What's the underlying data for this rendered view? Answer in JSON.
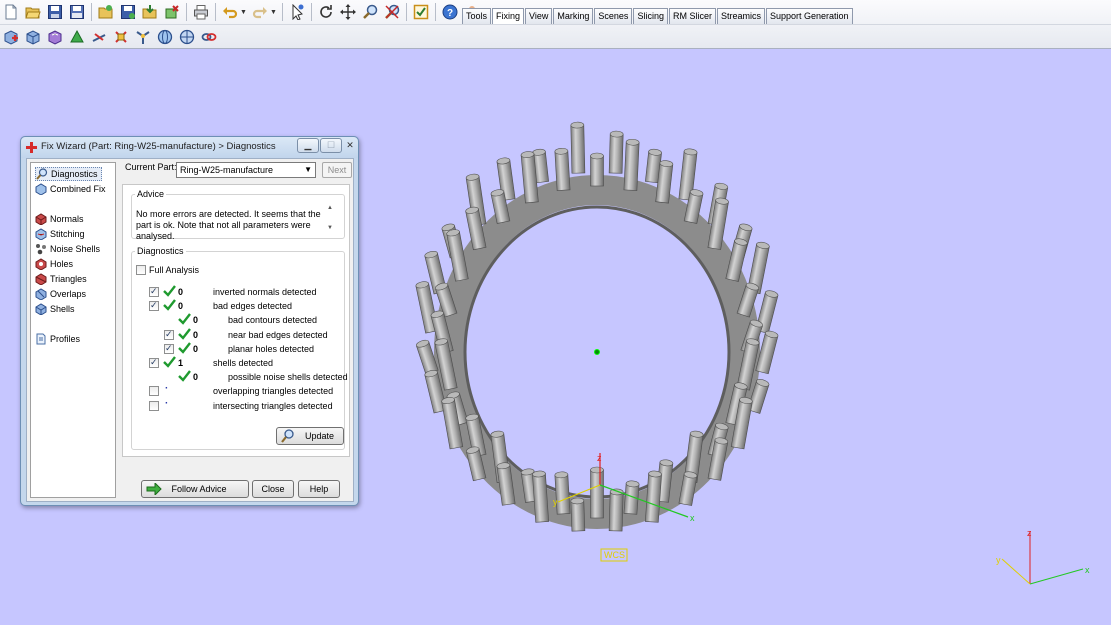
{
  "toolbar": {
    "row1_icons": [
      "new-file-icon",
      "open-folder-icon",
      "save-icon",
      "save-as-icon",
      "open-project-icon",
      "save-project-icon",
      "import-icon",
      "export-icon",
      "print-icon",
      "undo-icon",
      "redo-icon",
      "select-icon",
      "rotate-icon",
      "pan-icon",
      "zoom-icon",
      "zoom-extents-icon",
      "checklist-icon",
      "help-icon",
      "tools-wizard-icon"
    ],
    "row2_icons": [
      "fix-wizard-icon",
      "normals-icon",
      "stitch-icon",
      "triangles-icon",
      "cut-icon",
      "trim-icon",
      "marker-icon",
      "sphere-icon",
      "globe-icon",
      "link-icon"
    ],
    "tabs": [
      "Tools",
      "Fixing",
      "View",
      "Marking",
      "Scenes",
      "Slicing",
      "RM Slicer",
      "Streamics",
      "Support Generation"
    ],
    "active_tab": "Fixing"
  },
  "dialog": {
    "title": "Fix Wizard (Part: Ring-W25-manufacture) > Diagnostics",
    "nav": {
      "top": [
        "Diagnostics",
        "Combined Fix"
      ],
      "middle": [
        "Normals",
        "Stitching",
        "Noise Shells",
        "Holes",
        "Triangles",
        "Overlaps",
        "Shells"
      ],
      "bottom": [
        "Profiles"
      ],
      "selected": "Diagnostics"
    },
    "current_part_label": "Current Part:",
    "current_part_value": "Ring-W25-manufacture",
    "next_button": "Next",
    "advice": {
      "legend": "Advice",
      "text": "No more errors are detected. It seems that the part is ok. Note that not all parameters were analysed."
    },
    "diagnostics": {
      "legend": "Diagnostics",
      "full_analysis_label": "Full Analysis",
      "rows": [
        {
          "label": "inverted normals detected",
          "count": "0",
          "checked": true,
          "status": "ok"
        },
        {
          "label": "bad edges detected",
          "count": "0",
          "checked": true,
          "status": "ok"
        },
        {
          "label": "bad contours detected",
          "count": "0",
          "checked": null,
          "status": "ok"
        },
        {
          "label": "near bad edges detected",
          "count": "0",
          "checked": true,
          "status": "ok"
        },
        {
          "label": "planar holes detected",
          "count": "0",
          "checked": true,
          "status": "ok"
        },
        {
          "label": "shells detected",
          "count": "1",
          "checked": true,
          "status": "ok"
        },
        {
          "label": "possible noise shells detected",
          "count": "0",
          "checked": null,
          "status": "ok"
        },
        {
          "label": "overlapping triangles detected",
          "count": "",
          "checked": false,
          "status": "pending"
        },
        {
          "label": "intersecting triangles detected",
          "count": "",
          "checked": false,
          "status": "pending"
        }
      ],
      "update_button": "Update"
    },
    "buttons": {
      "follow_advice": "Follow Advice",
      "close": "Close",
      "help": "Help"
    }
  },
  "viewport": {
    "background": "#c6c6ff",
    "part_color": "#b9b9b9",
    "wcs_label": "WCS",
    "axis_x": "x",
    "axis_y": "y",
    "axis_z": "z",
    "axis_colors": {
      "x": "#22c822",
      "y": "#e0d000",
      "z": "#e02020"
    }
  }
}
